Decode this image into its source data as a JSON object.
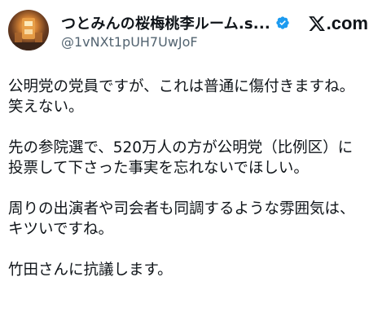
{
  "author": {
    "display_name": "つとみんの桜梅桃李ルーム.s...",
    "handle": "@1vNXt1pUH7UwJoF",
    "verified": true,
    "avatar_icon": "avatar-image"
  },
  "brand": {
    "logo_text": ".com",
    "logo_icon": "x-logo-icon"
  },
  "post": {
    "paragraphs": [
      {
        "lines": [
          "公明党の党員ですが、これは普通に傷付きますね。",
          "笑えない。"
        ]
      },
      {
        "lines": [
          "先の参院選で、520万人の方が公明党（比例区）に",
          "投票して下さった事実を忘れないでほしい。"
        ]
      },
      {
        "lines": [
          "周りの出演者や司会者も同調するような雰囲気は、",
          "キツいですね。"
        ]
      },
      {
        "lines": [
          "竹田さんに抗議します。"
        ]
      }
    ]
  },
  "colors": {
    "text": "#0f1419",
    "secondary": "#536471",
    "verified_badge": "#1d9bf0"
  }
}
